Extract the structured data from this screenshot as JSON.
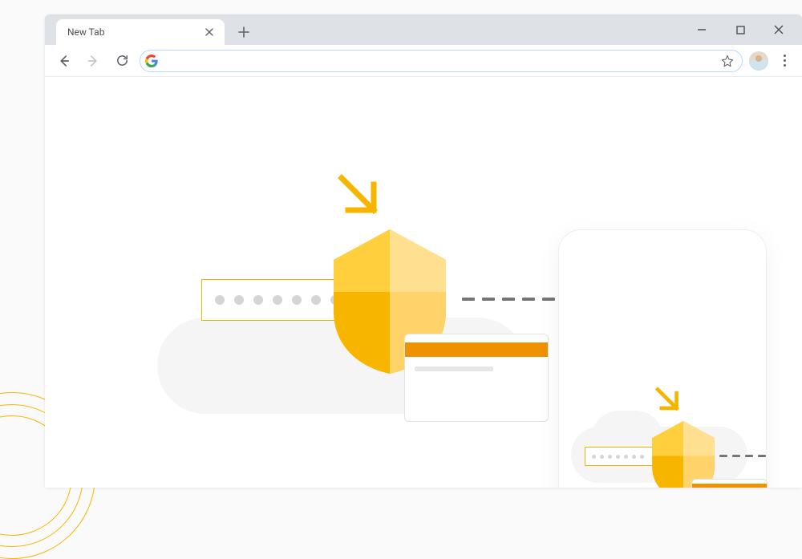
{
  "tab": {
    "title": "New Tab"
  },
  "omnibox": {
    "value": "",
    "placeholder": ""
  },
  "colors": {
    "amber": "#f7b500",
    "amber_light": "#ffd36a",
    "orange": "#f09102",
    "grey_dash": "#757575"
  }
}
